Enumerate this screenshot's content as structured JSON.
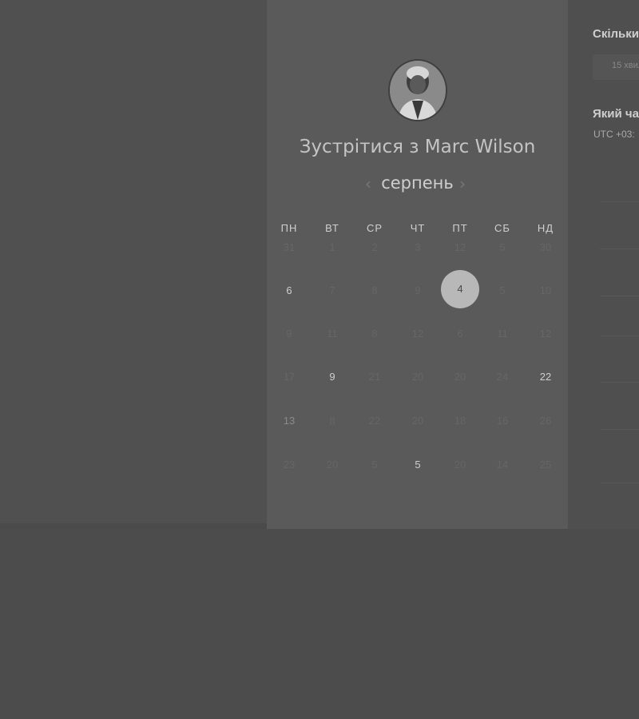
{
  "calendar": {
    "title": "Зустрітися з Marc Wilson",
    "month_label": "серпень",
    "prev_icon": "‹",
    "next_icon": "›",
    "weekdays": [
      "ПН",
      "ВТ",
      "СР",
      "ЧТ",
      "ПТ",
      "СБ",
      "НД"
    ],
    "weeks": [
      [
        "31",
        "1",
        "2",
        "3",
        "12",
        "5",
        "30"
      ],
      [
        "6",
        "7",
        "8",
        "9",
        "4",
        "5",
        "10"
      ],
      [
        "9",
        "11",
        "8",
        "12",
        "6",
        "11",
        "12"
      ],
      [
        "17",
        "9",
        "21",
        "20",
        "20",
        "24",
        "22"
      ],
      [
        "13",
        "8",
        "22",
        "20",
        "18",
        "16",
        "26"
      ],
      [
        "23",
        "20",
        "5",
        "5",
        "20",
        "14",
        "25"
      ]
    ],
    "selected_day": "4"
  },
  "right_panel": {
    "duration_heading": "Скільки",
    "duration_value": "15 хвил",
    "time_heading": "Який ча",
    "timezone": "UTC +03:"
  },
  "colors": {
    "overlay_bg": "#4c4c4c",
    "panel_bg": "#5a5a5a",
    "selected_day_bg": "#b8b8b8"
  }
}
